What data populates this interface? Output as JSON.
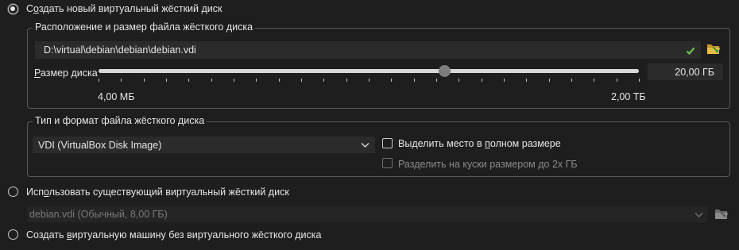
{
  "options": {
    "create_new": {
      "label_pre": "С",
      "label_acc": "о",
      "label_post": "здать новый виртуальный жёсткий диск"
    },
    "use_existing": {
      "label_pre": "Исп",
      "label_acc": "о",
      "label_post": "льзовать существующий виртуальный жёсткий диск"
    },
    "no_disk": {
      "label_pre": "Создать ",
      "label_acc": "в",
      "label_post": "иртуальную машину без виртуального жёсткого диска"
    }
  },
  "location_group": {
    "title": "Расположение и размер файла жёсткого диска",
    "path_value": "D:\\virtual\\debian\\debian\\debian.vdi",
    "size_label_acc": "Р",
    "size_label_post": "азмер диска",
    "size_value": "20,00 ГБ",
    "slider_min_label": "4,00 МБ",
    "slider_max_label": "2,00 ТБ",
    "slider_level_percent": 64
  },
  "format_group": {
    "title": "Тип и формат файла жёсткого диска",
    "selected_format": "VDI (VirtualBox Disk Image)",
    "preallocate_label_pre": "Выделить место в ",
    "preallocate_label_acc": "п",
    "preallocate_label_post": "олном размере",
    "split_label": "Разделить на куски размером до 2х ГБ"
  },
  "existing_disk": {
    "selected_value": "debian.vdi (Обычный, 8,00 ГБ)"
  },
  "colors": {
    "background": "#1e1e1e",
    "field": "#2b2b2b",
    "border": "#5a5a5a",
    "text": "#e6e6e6",
    "disabled_text": "#8a8a8a",
    "valid_check": "#6fc34a",
    "folder_icon": "#e0b13a"
  },
  "icons": [
    "valid-check-icon",
    "folder-open-icon",
    "chevron-down-icon",
    "folder-disabled-icon"
  ]
}
